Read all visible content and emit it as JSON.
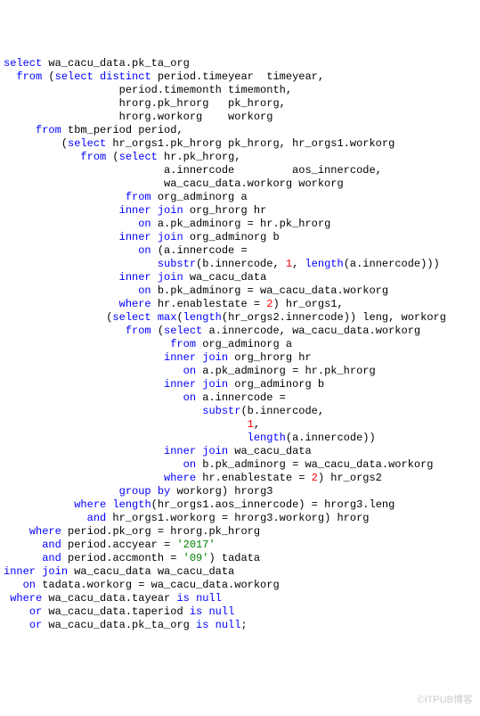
{
  "watermark": "©ITPUB博客",
  "code": {
    "t": [
      {
        "i": 0,
        "p": [
          [
            "kw",
            "select"
          ],
          [
            "",
            " wa_cacu_data.pk_ta_org"
          ]
        ]
      },
      {
        "i": 2,
        "p": [
          [
            "kw",
            "from"
          ],
          [
            "",
            " ("
          ],
          [
            "kw",
            "select"
          ],
          [
            "",
            " "
          ],
          [
            "kw",
            "distinct"
          ],
          [
            "",
            " period.timeyear  timeyear,"
          ]
        ]
      },
      {
        "i": 18,
        "p": [
          [
            "",
            "period.timemonth timemonth,"
          ]
        ]
      },
      {
        "i": 18,
        "p": [
          [
            "",
            "hrorg.pk_hrorg   pk_hrorg,"
          ]
        ]
      },
      {
        "i": 18,
        "p": [
          [
            "",
            "hrorg.workorg    workorg"
          ]
        ]
      },
      {
        "i": 5,
        "p": [
          [
            "kw",
            "from"
          ],
          [
            "",
            " tbm_period period,"
          ]
        ]
      },
      {
        "i": 9,
        "p": [
          [
            "",
            "("
          ],
          [
            "kw",
            "select"
          ],
          [
            "",
            " hr_orgs1.pk_hrorg pk_hrorg, hr_orgs1.workorg"
          ]
        ]
      },
      {
        "i": 12,
        "p": [
          [
            "kw",
            "from"
          ],
          [
            "",
            " ("
          ],
          [
            "kw",
            "select"
          ],
          [
            "",
            " hr.pk_hrorg,"
          ]
        ]
      },
      {
        "i": 25,
        "p": [
          [
            "",
            "a.innercode         aos_innercode,"
          ]
        ]
      },
      {
        "i": 25,
        "p": [
          [
            "",
            "wa_cacu_data.workorg workorg"
          ]
        ]
      },
      {
        "i": 19,
        "p": [
          [
            "kw",
            "from"
          ],
          [
            "",
            " org_adminorg a"
          ]
        ]
      },
      {
        "i": 18,
        "p": [
          [
            "kw",
            "inner"
          ],
          [
            "",
            " "
          ],
          [
            "kw",
            "join"
          ],
          [
            "",
            " org_hrorg hr"
          ]
        ]
      },
      {
        "i": 21,
        "p": [
          [
            "kw",
            "on"
          ],
          [
            "",
            " a.pk_adminorg = hr.pk_hrorg"
          ]
        ]
      },
      {
        "i": 18,
        "p": [
          [
            "kw",
            "inner"
          ],
          [
            "",
            " "
          ],
          [
            "kw",
            "join"
          ],
          [
            "",
            " org_adminorg b"
          ]
        ]
      },
      {
        "i": 21,
        "p": [
          [
            "kw",
            "on"
          ],
          [
            "",
            " (a.innercode ="
          ]
        ]
      },
      {
        "i": 24,
        "p": [
          [
            "kw",
            "substr"
          ],
          [
            "",
            "(b.innercode, "
          ],
          [
            "num",
            "1"
          ],
          [
            "",
            ", "
          ],
          [
            "kw",
            "length"
          ],
          [
            "",
            "(a.innercode)))"
          ]
        ]
      },
      {
        "i": 18,
        "p": [
          [
            "kw",
            "inner"
          ],
          [
            "",
            " "
          ],
          [
            "kw",
            "join"
          ],
          [
            "",
            " wa_cacu_data"
          ]
        ]
      },
      {
        "i": 21,
        "p": [
          [
            "kw",
            "on"
          ],
          [
            "",
            " b.pk_adminorg = wa_cacu_data.workorg"
          ]
        ]
      },
      {
        "i": 18,
        "p": [
          [
            "kw",
            "where"
          ],
          [
            "",
            " hr.enablestate = "
          ],
          [
            "num",
            "2"
          ],
          [
            "",
            ") hr_orgs1,"
          ]
        ]
      },
      {
        "i": 16,
        "p": [
          [
            "",
            "("
          ],
          [
            "kw",
            "select"
          ],
          [
            "",
            " "
          ],
          [
            "kw",
            "max"
          ],
          [
            "",
            "("
          ],
          [
            "kw",
            "length"
          ],
          [
            "",
            "(hr_orgs2.innercode)) leng, workorg"
          ]
        ]
      },
      {
        "i": 19,
        "p": [
          [
            "kw",
            "from"
          ],
          [
            "",
            " ("
          ],
          [
            "kw",
            "select"
          ],
          [
            "",
            " a.innercode, wa_cacu_data.workorg"
          ]
        ]
      },
      {
        "i": 26,
        "p": [
          [
            "kw",
            "from"
          ],
          [
            "",
            " org_adminorg a"
          ]
        ]
      },
      {
        "i": 25,
        "p": [
          [
            "kw",
            "inner"
          ],
          [
            "",
            " "
          ],
          [
            "kw",
            "join"
          ],
          [
            "",
            " org_hrorg hr"
          ]
        ]
      },
      {
        "i": 28,
        "p": [
          [
            "kw",
            "on"
          ],
          [
            "",
            " a.pk_adminorg = hr.pk_hrorg"
          ]
        ]
      },
      {
        "i": 25,
        "p": [
          [
            "kw",
            "inner"
          ],
          [
            "",
            " "
          ],
          [
            "kw",
            "join"
          ],
          [
            "",
            " org_adminorg b"
          ]
        ]
      },
      {
        "i": 28,
        "p": [
          [
            "kw",
            "on"
          ],
          [
            "",
            " a.innercode ="
          ]
        ]
      },
      {
        "i": 31,
        "p": [
          [
            "kw",
            "substr"
          ],
          [
            "",
            "(b.innercode,"
          ]
        ]
      },
      {
        "i": 38,
        "p": [
          [
            "num",
            "1"
          ],
          [
            "",
            ","
          ]
        ]
      },
      {
        "i": 38,
        "p": [
          [
            "kw",
            "length"
          ],
          [
            "",
            "(a.innercode))"
          ]
        ]
      },
      {
        "i": 25,
        "p": [
          [
            "kw",
            "inner"
          ],
          [
            "",
            " "
          ],
          [
            "kw",
            "join"
          ],
          [
            "",
            " wa_cacu_data"
          ]
        ]
      },
      {
        "i": 28,
        "p": [
          [
            "kw",
            "on"
          ],
          [
            "",
            " b.pk_adminorg = wa_cacu_data.workorg"
          ]
        ]
      },
      {
        "i": 25,
        "p": [
          [
            "kw",
            "where"
          ],
          [
            "",
            " hr.enablestate = "
          ],
          [
            "num",
            "2"
          ],
          [
            "",
            ") hr_orgs2"
          ]
        ]
      },
      {
        "i": 18,
        "p": [
          [
            "kw",
            "group"
          ],
          [
            "",
            " "
          ],
          [
            "kw",
            "by"
          ],
          [
            "",
            " workorg) hrorg3"
          ]
        ]
      },
      {
        "i": 11,
        "p": [
          [
            "kw",
            "where"
          ],
          [
            "",
            " "
          ],
          [
            "kw",
            "length"
          ],
          [
            "",
            "(hr_orgs1.aos_innercode) = hrorg3.leng"
          ]
        ]
      },
      {
        "i": 13,
        "p": [
          [
            "kw",
            "and"
          ],
          [
            "",
            " hr_orgs1.workorg = hrorg3.workorg) hrorg"
          ]
        ]
      },
      {
        "i": 4,
        "p": [
          [
            "kw",
            "where"
          ],
          [
            "",
            " period.pk_org = hrorg.pk_hrorg"
          ]
        ]
      },
      {
        "i": 6,
        "p": [
          [
            "kw",
            "and"
          ],
          [
            "",
            " period.accyear = "
          ],
          [
            "str",
            "'2017'"
          ]
        ]
      },
      {
        "i": 6,
        "p": [
          [
            "kw",
            "and"
          ],
          [
            "",
            " period.accmonth = "
          ],
          [
            "str",
            "'09'"
          ],
          [
            "",
            ") tadata"
          ]
        ]
      },
      {
        "i": 0,
        "p": [
          [
            "kw",
            "inner"
          ],
          [
            "",
            " "
          ],
          [
            "kw",
            "join"
          ],
          [
            "",
            " wa_cacu_data wa_cacu_data"
          ]
        ]
      },
      {
        "i": 3,
        "p": [
          [
            "kw",
            "on"
          ],
          [
            "",
            " tadata.workorg = wa_cacu_data.workorg"
          ]
        ]
      },
      {
        "i": 1,
        "p": [
          [
            "kw",
            "where"
          ],
          [
            "",
            " wa_cacu_data.tayear "
          ],
          [
            "kw",
            "is"
          ],
          [
            "",
            " "
          ],
          [
            "kw",
            "null"
          ]
        ]
      },
      {
        "i": 4,
        "p": [
          [
            "kw",
            "or"
          ],
          [
            "",
            " wa_cacu_data.taperiod "
          ],
          [
            "kw",
            "is"
          ],
          [
            "",
            " "
          ],
          [
            "kw",
            "null"
          ]
        ]
      },
      {
        "i": 4,
        "p": [
          [
            "kw",
            "or"
          ],
          [
            "",
            " wa_cacu_data.pk_ta_org "
          ],
          [
            "kw",
            "is"
          ],
          [
            "",
            " "
          ],
          [
            "kw",
            "null"
          ],
          [
            "",
            ";"
          ]
        ]
      }
    ]
  },
  "chart_data": {
    "type": "table",
    "title": "SQL Query",
    "sql": "select wa_cacu_data.pk_ta_org\n  from (select distinct period.timeyear  timeyear,\n                  period.timemonth timemonth,\n                  hrorg.pk_hrorg   pk_hrorg,\n                  hrorg.workorg    workorg\n     from tbm_period period,\n         (select hr_orgs1.pk_hrorg pk_hrorg, hr_orgs1.workorg\n            from (select hr.pk_hrorg,\n                         a.innercode         aos_innercode,\n                         wa_cacu_data.workorg workorg\n                   from org_adminorg a\n                  inner join org_hrorg hr\n                     on a.pk_adminorg = hr.pk_hrorg\n                  inner join org_adminorg b\n                     on (a.innercode =\n                        substr(b.innercode, 1, length(a.innercode)))\n                  inner join wa_cacu_data\n                     on b.pk_adminorg = wa_cacu_data.workorg\n                  where hr.enablestate = 2) hr_orgs1,\n                (select max(length(hr_orgs2.innercode)) leng, workorg\n                   from (select a.innercode, wa_cacu_data.workorg\n                          from org_adminorg a\n                         inner join org_hrorg hr\n                            on a.pk_adminorg = hr.pk_hrorg\n                         inner join org_adminorg b\n                            on a.innercode =\n                               substr(b.innercode,\n                                      1,\n                                      length(a.innercode))\n                         inner join wa_cacu_data\n                            on b.pk_adminorg = wa_cacu_data.workorg\n                         where hr.enablestate = 2) hr_orgs2\n                  group by workorg) hrorg3\n           where length(hr_orgs1.aos_innercode) = hrorg3.leng\n             and hr_orgs1.workorg = hrorg3.workorg) hrorg\n    where period.pk_org = hrorg.pk_hrorg\n      and period.accyear = '2017'\n      and period.accmonth = '09') tadata\ninner join wa_cacu_data wa_cacu_data\n   on tadata.workorg = wa_cacu_data.workorg\n where wa_cacu_data.tayear is null\n    or wa_cacu_data.taperiod is null\n    or wa_cacu_data.pk_ta_org is null;"
  }
}
